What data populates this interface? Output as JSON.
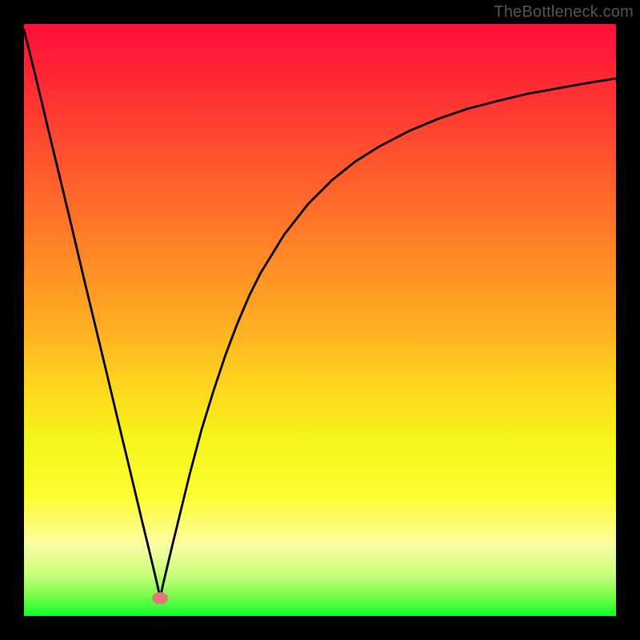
{
  "watermark": "TheBottleneck.com",
  "chart_data": {
    "type": "line",
    "title": "",
    "xlabel": "",
    "ylabel": "",
    "xlim": [
      0,
      100
    ],
    "ylim": [
      0,
      100
    ],
    "grid": false,
    "legend": false,
    "background_gradient": [
      "#fe1038",
      "#10fd2e"
    ],
    "marker": {
      "x": 23,
      "y": 3,
      "color": "#e07a7a",
      "size": 10
    },
    "series": [
      {
        "name": "curve",
        "color": "#000000",
        "x": [
          0,
          2,
          4,
          6,
          8,
          10,
          12,
          14,
          16,
          18,
          20,
          21,
          22,
          22.5,
          23,
          23.5,
          24,
          25,
          26,
          28,
          30,
          32,
          34,
          36,
          38,
          40,
          44,
          48,
          52,
          56,
          60,
          65,
          70,
          75,
          80,
          85,
          90,
          95,
          100
        ],
        "values": [
          99,
          91,
          82.6,
          74.3,
          66,
          57.5,
          49.2,
          40.9,
          32.5,
          24.2,
          15.8,
          11.7,
          7.5,
          5.4,
          3,
          5.4,
          7.5,
          11.7,
          15.8,
          24,
          31.5,
          38,
          44,
          49.3,
          54,
          58,
          64.5,
          69.6,
          73.6,
          76.8,
          79.3,
          81.9,
          84,
          85.7,
          87,
          88.2,
          89.1,
          90,
          90.8
        ]
      }
    ]
  }
}
